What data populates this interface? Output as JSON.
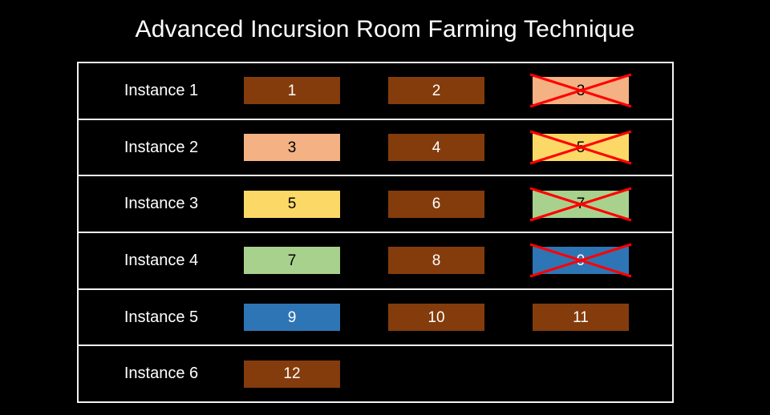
{
  "slide": {
    "background_color": "#000000",
    "title": "Advanced Incursion Room Farming Technique"
  },
  "palette": {
    "brown": "#843C0C",
    "peach": "#F4B183",
    "yellow": "#FCD966",
    "green": "#A9D18E",
    "blue": "#2E75B6",
    "cross": "#FF0000",
    "border": "#F2F2F2",
    "text_light": "#FFFFFF",
    "text_dark": "#000000"
  },
  "table": {
    "rows": [
      {
        "label": "Instance 1",
        "cells": [
          {
            "value": "1",
            "fill": "#843C0C",
            "text_color": "#FFFFFF",
            "crossed": false,
            "empty": false
          },
          {
            "value": "2",
            "fill": "#843C0C",
            "text_color": "#FFFFFF",
            "crossed": false,
            "empty": false
          },
          {
            "value": "3",
            "fill": "#F4B183",
            "text_color": "#000000",
            "crossed": true,
            "empty": false
          }
        ]
      },
      {
        "label": "Instance 2",
        "cells": [
          {
            "value": "3",
            "fill": "#F4B183",
            "text_color": "#000000",
            "crossed": false,
            "empty": false
          },
          {
            "value": "4",
            "fill": "#843C0C",
            "text_color": "#FFFFFF",
            "crossed": false,
            "empty": false
          },
          {
            "value": "5",
            "fill": "#FCD966",
            "text_color": "#000000",
            "crossed": true,
            "empty": false
          }
        ]
      },
      {
        "label": "Instance 3",
        "cells": [
          {
            "value": "5",
            "fill": "#FCD966",
            "text_color": "#000000",
            "crossed": false,
            "empty": false
          },
          {
            "value": "6",
            "fill": "#843C0C",
            "text_color": "#FFFFFF",
            "crossed": false,
            "empty": false
          },
          {
            "value": "7",
            "fill": "#A9D18E",
            "text_color": "#000000",
            "crossed": true,
            "empty": false
          }
        ]
      },
      {
        "label": "Instance 4",
        "cells": [
          {
            "value": "7",
            "fill": "#A9D18E",
            "text_color": "#000000",
            "crossed": false,
            "empty": false
          },
          {
            "value": "8",
            "fill": "#843C0C",
            "text_color": "#FFFFFF",
            "crossed": false,
            "empty": false
          },
          {
            "value": "9",
            "fill": "#2E75B6",
            "text_color": "#FFFFFF",
            "crossed": true,
            "empty": false
          }
        ]
      },
      {
        "label": "Instance 5",
        "cells": [
          {
            "value": "9",
            "fill": "#2E75B6",
            "text_color": "#FFFFFF",
            "crossed": false,
            "empty": false
          },
          {
            "value": "10",
            "fill": "#843C0C",
            "text_color": "#FFFFFF",
            "crossed": false,
            "empty": false
          },
          {
            "value": "11",
            "fill": "#843C0C",
            "text_color": "#FFFFFF",
            "crossed": false,
            "empty": false
          }
        ]
      },
      {
        "label": "Instance 6",
        "cells": [
          {
            "value": "12",
            "fill": "#843C0C",
            "text_color": "#FFFFFF",
            "crossed": false,
            "empty": false
          },
          {
            "value": "",
            "fill": "",
            "text_color": "",
            "crossed": false,
            "empty": true
          },
          {
            "value": "",
            "fill": "",
            "text_color": "",
            "crossed": false,
            "empty": true
          }
        ]
      }
    ]
  }
}
